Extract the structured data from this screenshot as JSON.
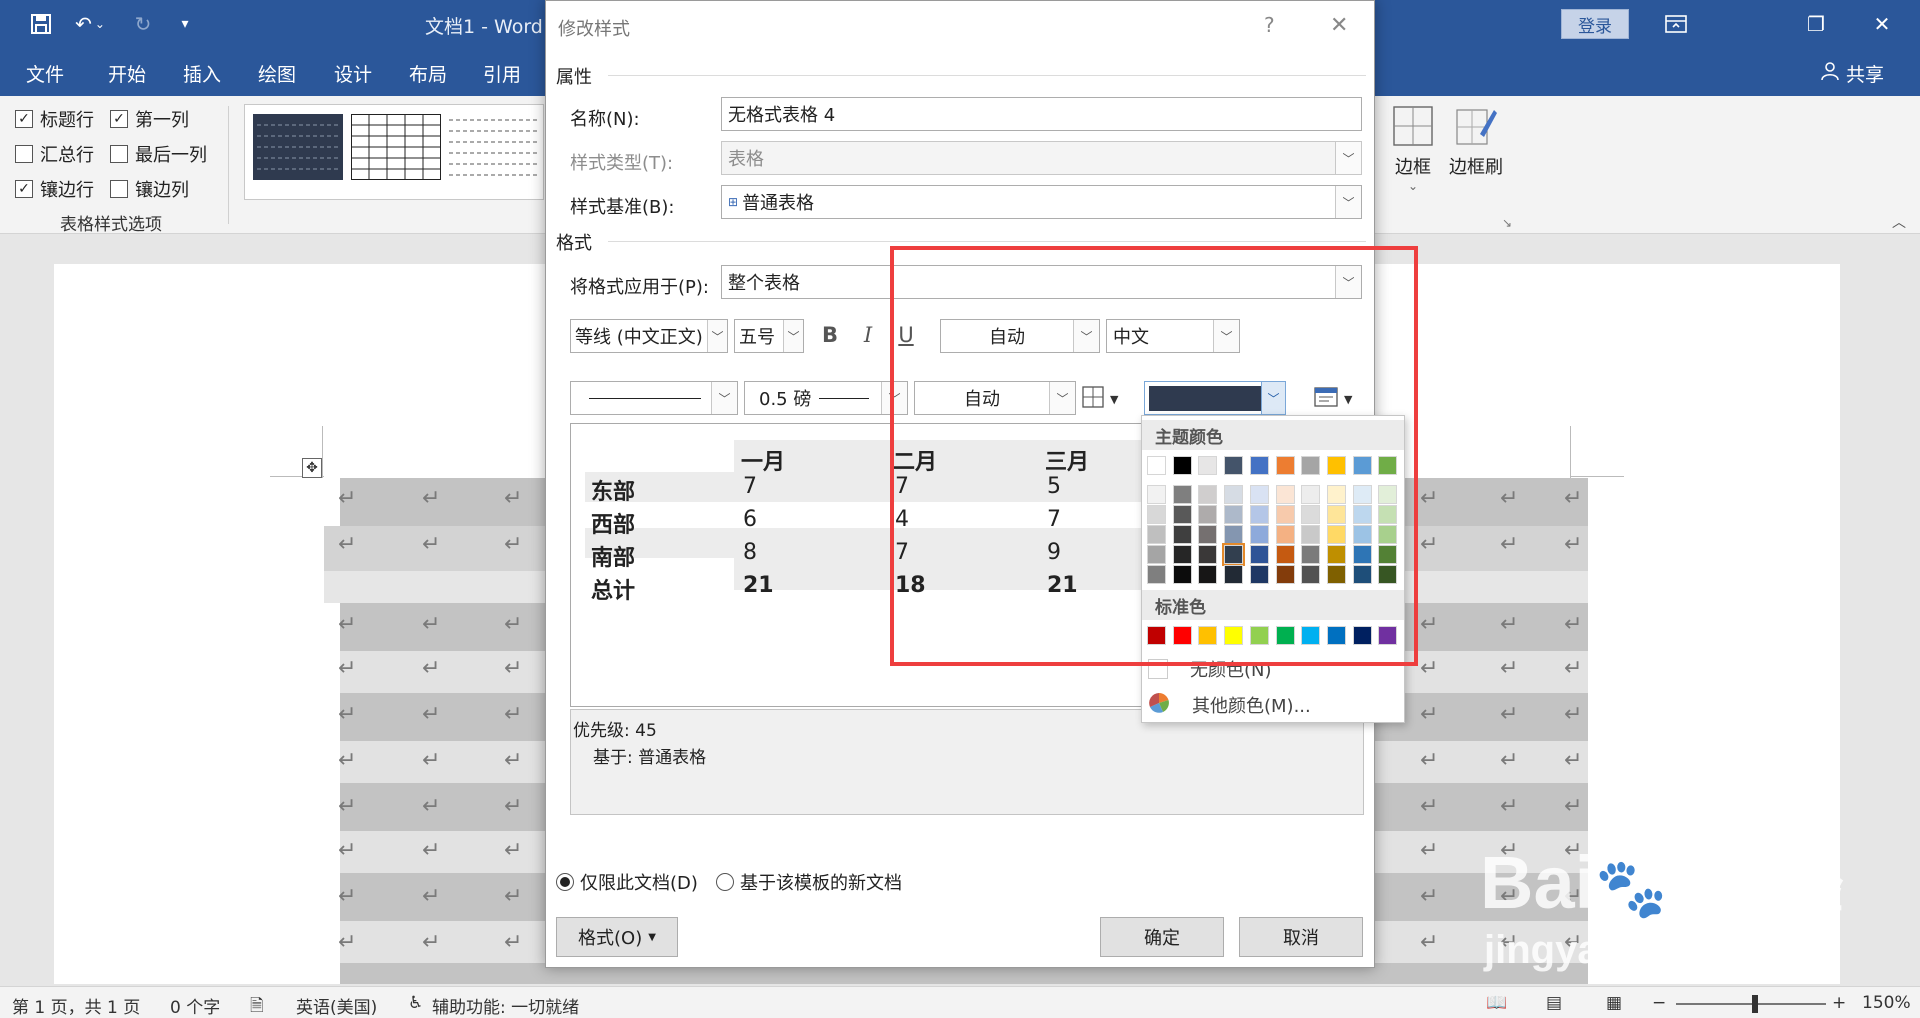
{
  "app": {
    "doc_title": "文档1  -  Word",
    "login_label": "登录",
    "share_label": "共享"
  },
  "menu": {
    "tabs": [
      "文件",
      "开始",
      "插入",
      "绘图",
      "设计",
      "布局",
      "引用"
    ]
  },
  "ribbon": {
    "options": [
      {
        "label": "标题行",
        "checked": true
      },
      {
        "label": "第一列",
        "checked": true
      },
      {
        "label": "汇总行",
        "checked": false
      },
      {
        "label": "最后一列",
        "checked": false
      },
      {
        "label": "镶边行",
        "checked": true
      },
      {
        "label": "镶边列",
        "checked": false
      }
    ],
    "group_label": "表格样式选项",
    "border_label": "边框",
    "border_painter_label": "边框刷"
  },
  "dialog": {
    "title": "修改样式",
    "help": "?",
    "close": "✕",
    "section_properties": "属性",
    "name_label": "名称(N):",
    "name_value": "无格式表格 4",
    "type_label": "样式类型(T):",
    "type_value": "表格",
    "based_label": "样式基准(B):",
    "based_value": "普通表格",
    "section_format": "格式",
    "apply_label": "将格式应用于(P):",
    "apply_value": "整个表格",
    "font_value": "等线 (中文正文)",
    "size_value": "五号",
    "bold": "B",
    "italic": "I",
    "underline": "U",
    "font_color_value": "自动",
    "script_value": "中文",
    "border_weight_value": "0.5 磅",
    "border_color_value": "自动",
    "shading_color": "#2f3a4f",
    "preview": {
      "headers": [
        "一月",
        "二月",
        "三月"
      ],
      "rows": [
        {
          "label": "东部",
          "values": [
            "7",
            "7",
            "5"
          ]
        },
        {
          "label": "西部",
          "values": [
            "6",
            "4",
            "7"
          ]
        },
        {
          "label": "南部",
          "values": [
            "8",
            "7",
            "9"
          ]
        }
      ],
      "total": {
        "label": "总计",
        "values": [
          "21",
          "18",
          "21"
        ]
      }
    },
    "description_line1": "优先级: 45",
    "description_line2": "基于: 普通表格",
    "radio_doc_only": "仅限此文档(D)",
    "radio_template": "基于该模板的新文档",
    "format_button": "格式(O)",
    "ok_button": "确定",
    "cancel_button": "取消"
  },
  "color_popup": {
    "theme_heading": "主题颜色",
    "standard_heading": "标准色",
    "no_color_label": "无颜色(N)",
    "more_colors_label": "其他颜色(M)...",
    "theme_top": [
      "#ffffff",
      "#000000",
      "#e7e6e6",
      "#44546a",
      "#4472c4",
      "#ed7d31",
      "#a5a5a5",
      "#ffc000",
      "#5b9bd5",
      "#70ad47"
    ],
    "theme_shades": [
      [
        "#f2f2f2",
        "#7f7f7f",
        "#d0cece",
        "#d6dce4",
        "#d9e2f3",
        "#fbe5d5",
        "#ededed",
        "#fff2cc",
        "#deebf6",
        "#e2efd9"
      ],
      [
        "#d8d8d8",
        "#595959",
        "#aeabab",
        "#adb9ca",
        "#b4c6e7",
        "#f7caac",
        "#dbdbdb",
        "#fee599",
        "#bdd7ee",
        "#c5e0b3"
      ],
      [
        "#bfbfbf",
        "#3f3f3f",
        "#757070",
        "#8496b0",
        "#8eaadb",
        "#f4b183",
        "#c9c9c9",
        "#ffd965",
        "#9cc3e5",
        "#a8d08d"
      ],
      [
        "#a5a5a5",
        "#262626",
        "#3a3838",
        "#323f4f",
        "#2f5496",
        "#c55a11",
        "#7b7b7b",
        "#bf8f00",
        "#2e75b5",
        "#538135"
      ],
      [
        "#7f7f7f",
        "#0c0c0c",
        "#171616",
        "#222a35",
        "#1f3864",
        "#833c0b",
        "#525252",
        "#7f6000",
        "#1e4e79",
        "#375623"
      ]
    ],
    "selected": {
      "row": 3,
      "col": 3
    },
    "standard": [
      "#c00000",
      "#ff0000",
      "#ffc000",
      "#ffff00",
      "#92d050",
      "#00b050",
      "#00b0f0",
      "#0070c0",
      "#002060",
      "#7030a0"
    ]
  },
  "status": {
    "page": "第 1 页，共 1 页",
    "words": "0 个字",
    "language": "英语(美国)",
    "accessibility": "辅助功能: 一切就绪",
    "zoom_minus": "−",
    "zoom_plus": "+",
    "zoom": "150%"
  },
  "watermark": {
    "brand": "Bai",
    "brand2": "du",
    "product": "经验",
    "url": "jingyan.baidu.com"
  }
}
